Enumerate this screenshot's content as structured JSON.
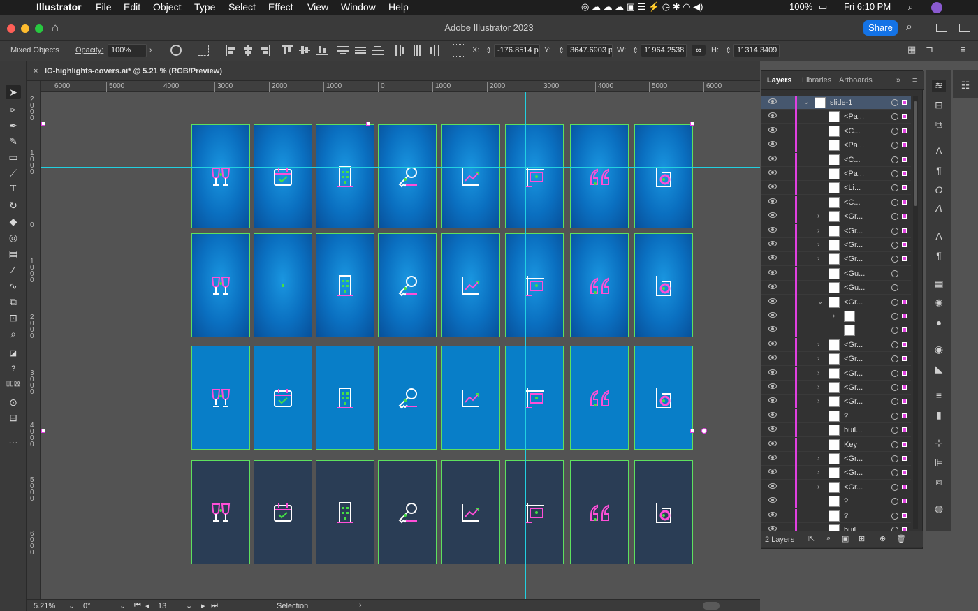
{
  "menubar": {
    "app": "Illustrator",
    "items": [
      "File",
      "Edit",
      "Object",
      "Type",
      "Select",
      "Effect",
      "View",
      "Window",
      "Help"
    ],
    "battery": "100%",
    "clock": "Fri 6:10 PM"
  },
  "window": {
    "title": "Adobe Illustrator 2023",
    "share_label": "Share"
  },
  "control_bar": {
    "selection_type": "Mixed Objects",
    "opacity_label": "Opacity:",
    "opacity_value": "100%",
    "x_label": "X:",
    "x_value": "-176.8514 p",
    "y_label": "Y:",
    "y_value": "3647.6903 p",
    "w_label": "W:",
    "w_value": "11964.2538",
    "h_label": "H:",
    "h_value": "11314.3409"
  },
  "document_tab": {
    "title": "IG-highlights-covers.ai* @ 5.21 % (RGB/Preview)"
  },
  "rulers": {
    "h_labels": [
      "6000",
      "5000",
      "4000",
      "3000",
      "2000",
      "1000",
      "0",
      "1000",
      "2000",
      "3000",
      "4000",
      "5000",
      "6000"
    ],
    "v_labels": [
      "2\n0\n0\n0",
      "1\n0\n0\n0",
      "0",
      "1\n0\n0\n0",
      "2\n0\n0\n0",
      "3\n0\n0\n0",
      "4\n0\n0\n0",
      "5\n0\n0\n0",
      "6\n0\n0\n0"
    ]
  },
  "artboards": {
    "rows": [
      {
        "style": "r1",
        "icons": [
          "glasses-icon",
          "calendar-check-icon",
          "building-icon",
          "key-icon",
          "chart-icon",
          "sign-icon",
          "quote-icon",
          "b-logo-icon"
        ]
      },
      {
        "style": "r2",
        "icons": [
          "glasses-icon",
          "dot-icon",
          "building-icon",
          "key-icon",
          "chart-icon",
          "sign-icon",
          "quote-icon",
          "b-logo-icon"
        ]
      },
      {
        "style": "r3",
        "icons": [
          "glasses-icon",
          "calendar-check-icon",
          "building-icon",
          "key-icon",
          "chart-icon",
          "sign-icon",
          "quote-icon",
          "b-logo-icon"
        ]
      },
      {
        "style": "r4",
        "icons": [
          "glasses-icon",
          "calendar-check-icon",
          "building-icon",
          "key-icon",
          "chart-icon",
          "sign-icon",
          "quote-icon",
          "b-logo-icon"
        ]
      }
    ]
  },
  "status_bar": {
    "zoom": "5.21%",
    "rotation": "0°",
    "artboard_number": "13",
    "tool": "Selection"
  },
  "layers_panel": {
    "tabs": [
      "Layers",
      "Libraries",
      "Artboards"
    ],
    "footer": "2 Layers",
    "rows": [
      {
        "name": "slide-1",
        "indent": 0,
        "arrow": "down"
      },
      {
        "name": "<Pa...",
        "indent": 1,
        "arrow": ""
      },
      {
        "name": "<C...",
        "indent": 1,
        "arrow": ""
      },
      {
        "name": "<Pa...",
        "indent": 1,
        "arrow": ""
      },
      {
        "name": "<C...",
        "indent": 1,
        "arrow": ""
      },
      {
        "name": "<Pa...",
        "indent": 1,
        "arrow": ""
      },
      {
        "name": "<Li...",
        "indent": 1,
        "arrow": ""
      },
      {
        "name": "<C...",
        "indent": 1,
        "arrow": ""
      },
      {
        "name": "<Gr...",
        "indent": 1,
        "arrow": "right"
      },
      {
        "name": "<Gr...",
        "indent": 1,
        "arrow": "right"
      },
      {
        "name": "<Gr...",
        "indent": 1,
        "arrow": "right"
      },
      {
        "name": "<Gr...",
        "indent": 1,
        "arrow": "right"
      },
      {
        "name": "<Gu...",
        "indent": 1,
        "arrow": ""
      },
      {
        "name": "<Gu...",
        "indent": 1,
        "arrow": ""
      },
      {
        "name": "<Gr...",
        "indent": 1,
        "arrow": "down"
      },
      {
        "name": "",
        "indent": 2,
        "arrow": "right"
      },
      {
        "name": "",
        "indent": 2,
        "arrow": ""
      },
      {
        "name": "<Gr...",
        "indent": 1,
        "arrow": "right"
      },
      {
        "name": "<Gr...",
        "indent": 1,
        "arrow": "right"
      },
      {
        "name": "<Gr...",
        "indent": 1,
        "arrow": "right"
      },
      {
        "name": "<Gr...",
        "indent": 1,
        "arrow": "right"
      },
      {
        "name": "<Gr...",
        "indent": 1,
        "arrow": "right"
      },
      {
        "name": "?",
        "indent": 1,
        "arrow": ""
      },
      {
        "name": "buil...",
        "indent": 1,
        "arrow": ""
      },
      {
        "name": "Key",
        "indent": 1,
        "arrow": ""
      },
      {
        "name": "<Gr...",
        "indent": 1,
        "arrow": "right"
      },
      {
        "name": "<Gr...",
        "indent": 1,
        "arrow": "right"
      },
      {
        "name": "<Gr...",
        "indent": 1,
        "arrow": "right"
      },
      {
        "name": "?",
        "indent": 1,
        "arrow": ""
      },
      {
        "name": "?",
        "indent": 1,
        "arrow": ""
      },
      {
        "name": "buil...",
        "indent": 1,
        "arrow": ""
      }
    ]
  },
  "colors": {
    "accent": "#1473e6",
    "artboard_border": "#5ee05e",
    "selection": "#e040e0",
    "guide": "#22d0e0",
    "icon_stroke": "#ffffff",
    "icon_accent": "#ff4fd8"
  }
}
